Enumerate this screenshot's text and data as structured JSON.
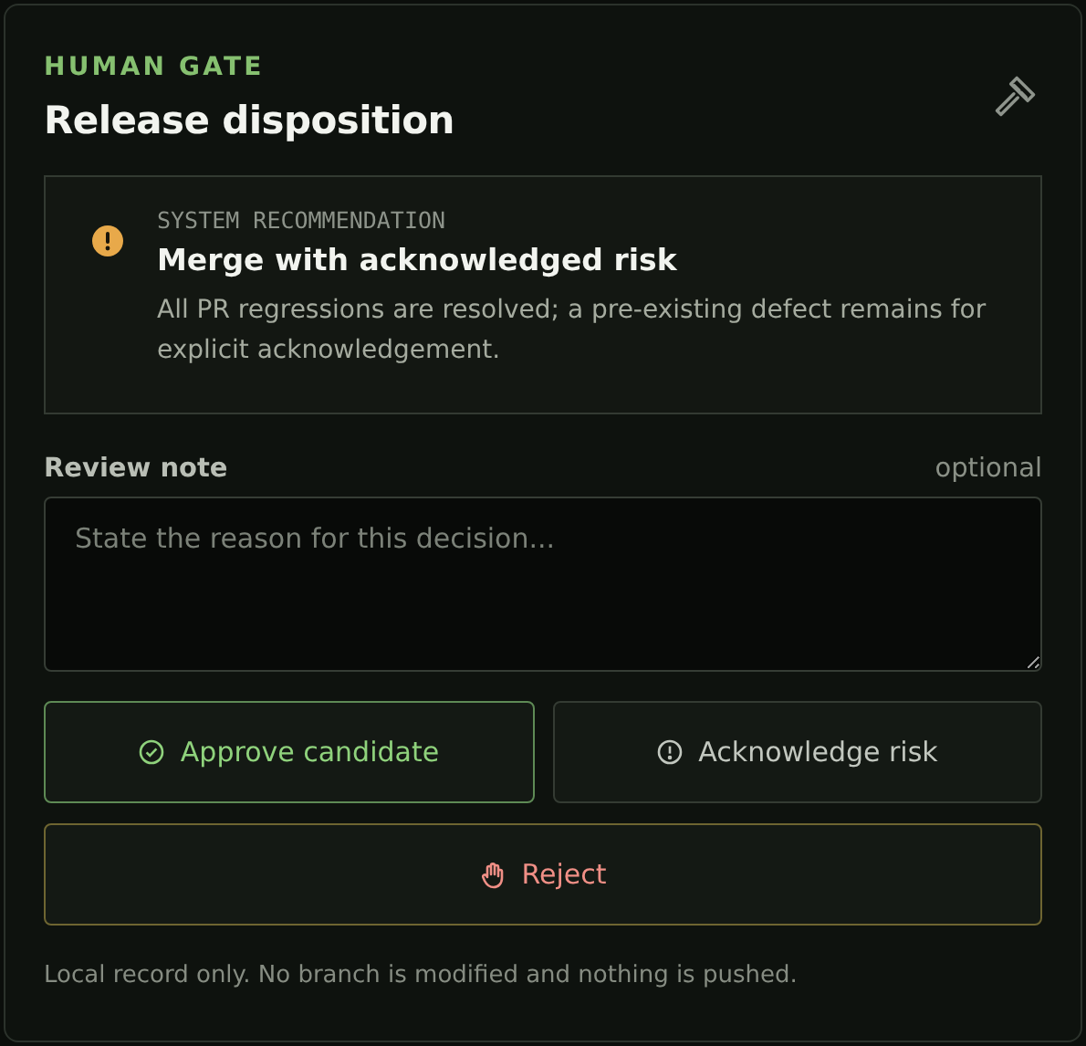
{
  "header": {
    "eyebrow": "HUMAN GATE",
    "title": "Release disposition"
  },
  "recommendation": {
    "label": "SYSTEM RECOMMENDATION",
    "title": "Merge with acknowledged risk",
    "body": "All PR regressions are resolved; a pre-existing defect remains for explicit acknowledgement."
  },
  "review_note": {
    "label": "Review note",
    "hint": "optional",
    "placeholder": "State the reason for this decision..."
  },
  "actions": [
    {
      "kind": "approve",
      "label": "Approve candidate"
    },
    {
      "kind": "acknowledge",
      "label": "Acknowledge risk"
    },
    {
      "kind": "reject",
      "label": "Reject"
    }
  ],
  "footer": "Local record only. No branch is modified and nothing is pushed."
}
